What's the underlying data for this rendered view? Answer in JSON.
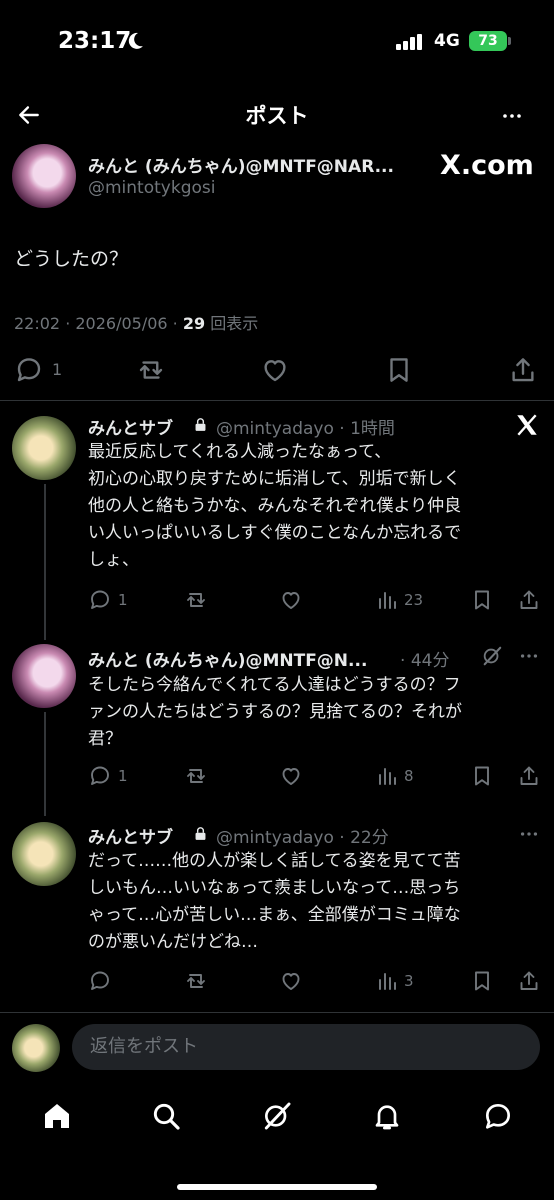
{
  "status_bar": {
    "time": "23:17",
    "network": "4G",
    "battery": "73"
  },
  "header": {
    "title": "ポスト"
  },
  "main_post": {
    "author_name": "みんと (みんちゃん)@MNTF@NAR...",
    "handle": "@mintotykgosi",
    "source_logo": "X.com",
    "text": "どうしたの？",
    "time": "22:02",
    "date": "2026/05/06",
    "views": "29",
    "views_label": "回表示",
    "replies": "1"
  },
  "replies": [
    {
      "name": "みんとサブ",
      "handle": "@mintyadayo",
      "time": "1時間",
      "lines": [
        "最近反応してくれる人減ったなぁって、",
        "初心の心取り戻すために垢消して、別垢で新しく",
        "他の人と絡もうかな、みんなそれぞれ僕より仲良",
        "い人いっぱいいるしすぐ僕のことなんか忘れるで",
        "しょ、"
      ],
      "replies": "1",
      "views": "23"
    },
    {
      "name": "みんと (みんちゃん)@MNTF@N...",
      "handle": "",
      "time": "44分",
      "lines": [
        "そしたら今絡んでくれてる人達はどうするの？フ",
        "ァンの人たちはどうするの？見捨てるの？それが",
        "君？"
      ],
      "replies": "1",
      "views": "8"
    },
    {
      "name": "みんとサブ",
      "handle": "@mintyadayo",
      "time": "22分",
      "lines": [
        "だって……他の人が楽しく話してる姿を見てて苦",
        "しいもん…いいなぁって羨ましいなって…思っち",
        "ゃって…心が苦しい…まぁ、全部僕がコミュ障な",
        "のが悪いんだけどね…"
      ],
      "replies": "",
      "views": "3"
    }
  ],
  "reply_bar": {
    "placeholder": "返信をポスト"
  },
  "icons": {
    "back": "arrow-left-icon",
    "more": "more-horizontal-icon",
    "reply": "comment-icon",
    "retweet": "repost-icon",
    "like": "heart-icon",
    "bookmark": "bookmark-icon",
    "share": "share-icon",
    "views": "views-bar-icon",
    "x_logo": "x-logo-icon",
    "lock": "lock-icon",
    "grok": "grok-icon",
    "home": "home-icon",
    "search": "search-icon",
    "notifications": "bell-icon",
    "messages": "message-icon"
  }
}
